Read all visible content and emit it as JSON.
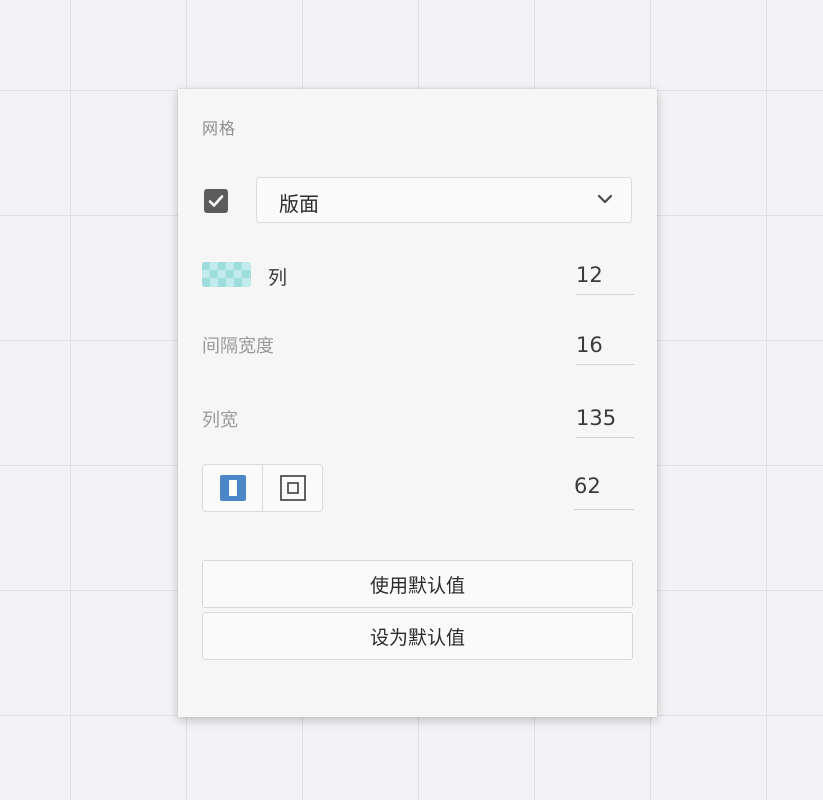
{
  "panel": {
    "section_title": "网格",
    "layout_enabled": true,
    "layout_select": {
      "value": "版面",
      "icon": "chevron-down-icon"
    },
    "columns": {
      "icon": "column-grid-swatch-icon",
      "label": "列",
      "value": "12"
    },
    "gutter": {
      "label": "间隔宽度",
      "value": "16"
    },
    "column_width": {
      "label": "列宽",
      "value": "135"
    },
    "margin_mode": {
      "options": [
        {
          "icon": "column-mode-icon",
          "selected": true
        },
        {
          "icon": "box-margin-icon",
          "selected": false
        }
      ],
      "value": "62"
    },
    "buttons": {
      "use_default": "使用默认值",
      "set_default": "设为默认值"
    }
  },
  "colors": {
    "accent": "#4a86c8",
    "checkbox": "#5c5c5c",
    "swatch_light": "#c2ecec",
    "swatch_dark": "#9fdcdc"
  }
}
